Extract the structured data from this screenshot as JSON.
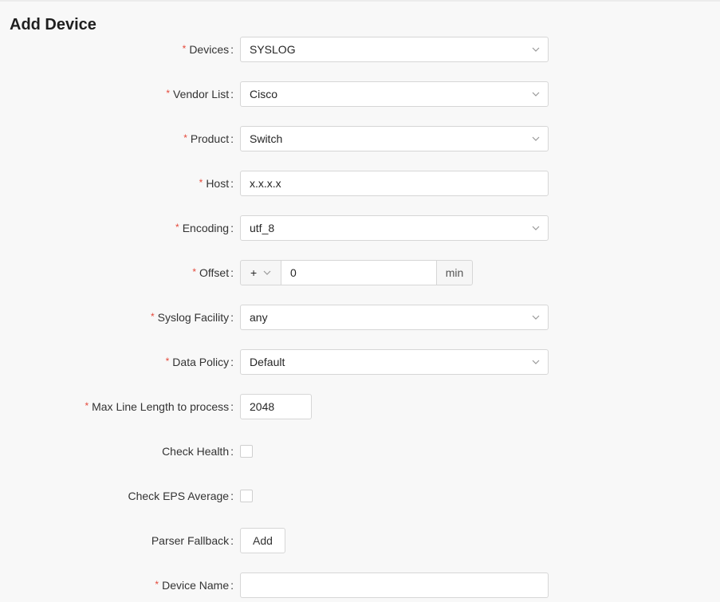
{
  "page": {
    "title": "Add Device"
  },
  "form": {
    "devices": {
      "label": "Devices",
      "value": "SYSLOG",
      "required": true
    },
    "vendor_list": {
      "label": "Vendor List",
      "value": "Cisco",
      "required": true
    },
    "product": {
      "label": "Product",
      "value": "Switch",
      "required": true
    },
    "host": {
      "label": "Host",
      "value": "x.x.x.x",
      "required": true
    },
    "encoding": {
      "label": "Encoding",
      "value": "utf_8",
      "required": true
    },
    "offset": {
      "label": "Offset",
      "sign": "+",
      "value": "0",
      "unit": "min",
      "required": true
    },
    "syslog_facility": {
      "label": "Syslog Facility",
      "value": "any",
      "required": true
    },
    "data_policy": {
      "label": "Data Policy",
      "value": "Default",
      "required": true
    },
    "max_line_length": {
      "label": "Max Line Length to process",
      "value": "2048",
      "required": true
    },
    "check_health": {
      "label": "Check Health",
      "checked": false
    },
    "check_eps_average": {
      "label": "Check EPS Average",
      "checked": false
    },
    "parser_fallback": {
      "label": "Parser Fallback",
      "button_label": "Add"
    },
    "device_name": {
      "label": "Device Name",
      "value": "",
      "required": true
    }
  },
  "symbols": {
    "required_mark": "*",
    "colon": ":"
  },
  "colors": {
    "required": "#e5483a",
    "border": "#d6d6d6",
    "background": "#f8f8f8"
  },
  "icons": {
    "select_arrow": "chevron-down-icon"
  }
}
